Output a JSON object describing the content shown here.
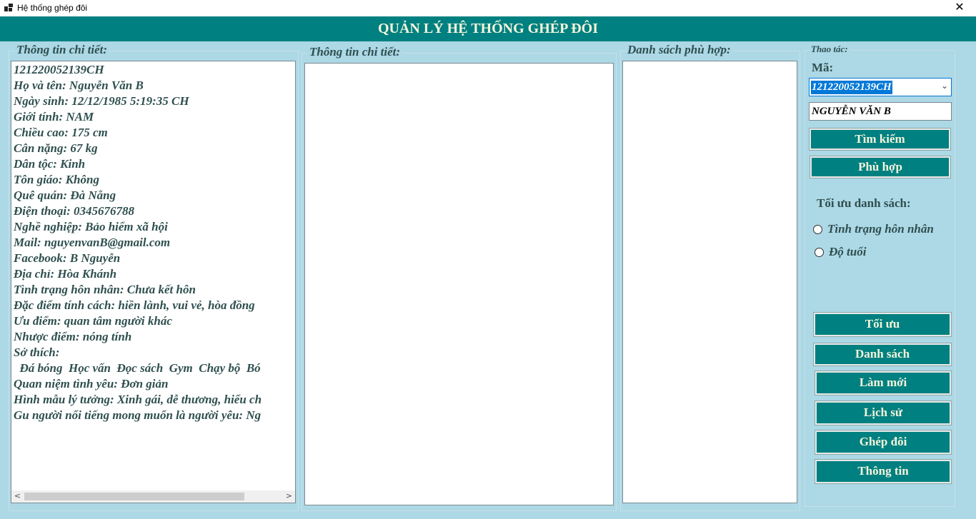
{
  "window": {
    "title": "Hệ thống ghép đôi",
    "close_glyph": "✕"
  },
  "header": {
    "title": "QUẢN LÝ HỆ THỐNG GHÉP ĐÔI"
  },
  "left_panel": {
    "title": "Thông tin chi tiết:",
    "lines": [
      "121220052139CH",
      "Họ và tên: Nguyễn Văn B",
      "Ngày sinh: 12/12/1985 5:19:35 CH",
      "Giới tính: NAM",
      "Chiều cao: 175 cm",
      "Cân nặng: 67 kg",
      "Dân tộc: Kinh",
      "Tôn giáo: Không",
      "Quê quán: Đà Nẵng",
      "Điện thoại: 0345676788",
      "Nghề nghiệp: Bảo hiểm xã hội",
      "Mail: nguyenvanB@gmail.com",
      "Facebook: B Nguyễn",
      "Địa chỉ: Hòa Khánh",
      "Tình trạng hôn nhân: Chưa kết hôn",
      "Đặc điểm tính cách: hiền lành, vui vẻ, hòa đồng",
      "Ưu điểm: quan tâm người khác",
      "Nhược điểm: nóng tính",
      "Sở thích:",
      "  Đá bóng  Học vấn  Đọc sách  Gym  Chạy bộ  Bó",
      "Quan niệm tình yêu: Đơn giản",
      "Hình mẫu lý tưởng: Xinh gái, dễ thương, hiểu ch",
      "Gu người nổi tiếng mong muốn là người yêu: Ng"
    ],
    "scroll_left": "<",
    "scroll_right": ">"
  },
  "middle_panel": {
    "title": "Thông tin chi tiết:"
  },
  "list_panel": {
    "title": "Danh sách phù hợp:"
  },
  "actions": {
    "title": "Thao tác:",
    "ma_label": "Mã:",
    "ma_value": "121220052139CH",
    "name_value": "NGUYỄN VĂN B",
    "search_button": "Tìm kiếm",
    "match_button": "Phù hợp",
    "optimize_title": "Tối ưu danh sách:",
    "radio_marital": "Tình trạng hôn nhân",
    "radio_age": "Độ tuổi",
    "optimize_button": "Tối ưu",
    "list_button": "Danh sách",
    "refresh_button": "Làm mới",
    "history_button": "Lịch sử",
    "pair_button": "Ghép đôi",
    "info_button": "Thông tin"
  },
  "colors": {
    "background": "#add8e6",
    "header": "#008080",
    "button": "#008080",
    "button_text": "#f5f5dc",
    "text": "#2f4f4f"
  },
  "icons": [
    "app-icon",
    "close-icon",
    "chevron-down-icon",
    "scroll-left-icon",
    "scroll-right-icon"
  ]
}
